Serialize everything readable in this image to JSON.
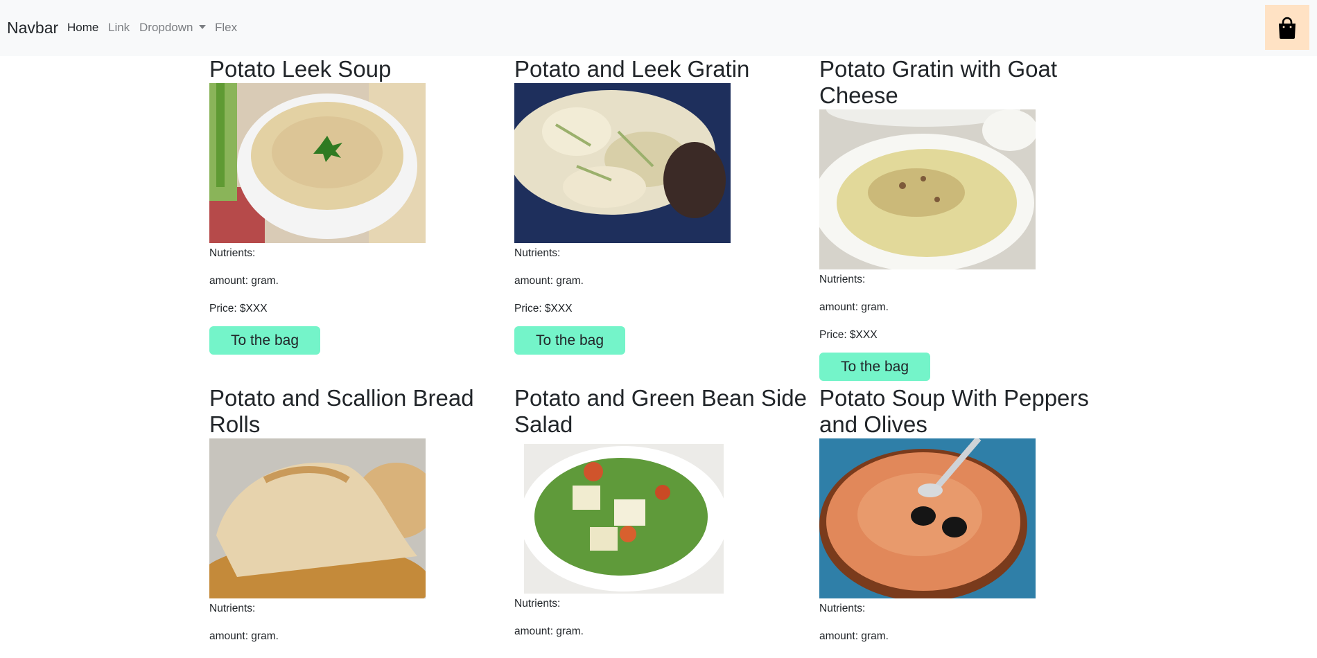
{
  "navbar": {
    "brand": "Navbar",
    "links": [
      "Home",
      "Link",
      "Dropdown",
      "Flex"
    ]
  },
  "colors": {
    "navbar_bg": "#f8f9fa",
    "bag_button_bg": "#ffe2c4",
    "cta_bg": "#74f4c9"
  },
  "bag_icon": "shopping-bag-icon",
  "recipes": [
    {
      "title": "Potato Leek Soup",
      "image": "bowl of creamy potato leek soup",
      "nutrients": "Nutrients:",
      "amount": "amount: gram.",
      "price": "Price: $XXX",
      "button": "To the bag"
    },
    {
      "title": "Potato and Leek Gratin",
      "image": "sliced potato and leek gratin",
      "nutrients": "Nutrients:",
      "amount": "amount: gram.",
      "price": "Price: $XXX",
      "button": "To the bag"
    },
    {
      "title": "Potato Gratin with Goat Cheese",
      "image": "potato gratin in white baking dish",
      "nutrients": "Nutrients:",
      "amount": "amount: gram.",
      "price": "Price: $XXX",
      "button": "To the bag"
    },
    {
      "title": "Potato and Scallion Bread Rolls",
      "image": "torn potato scallion bread roll",
      "nutrients": "Nutrients:",
      "amount": "amount: gram."
    },
    {
      "title": "Potato and Green Bean Side Salad",
      "image": "potato green bean salad with tomatoes",
      "nutrients": "Nutrients:",
      "amount": "amount: gram."
    },
    {
      "title": "Potato Soup With Peppers and Olives",
      "image": "orange soup with black olives and spoon",
      "nutrients": "Nutrients:",
      "amount": "amount: gram."
    }
  ]
}
